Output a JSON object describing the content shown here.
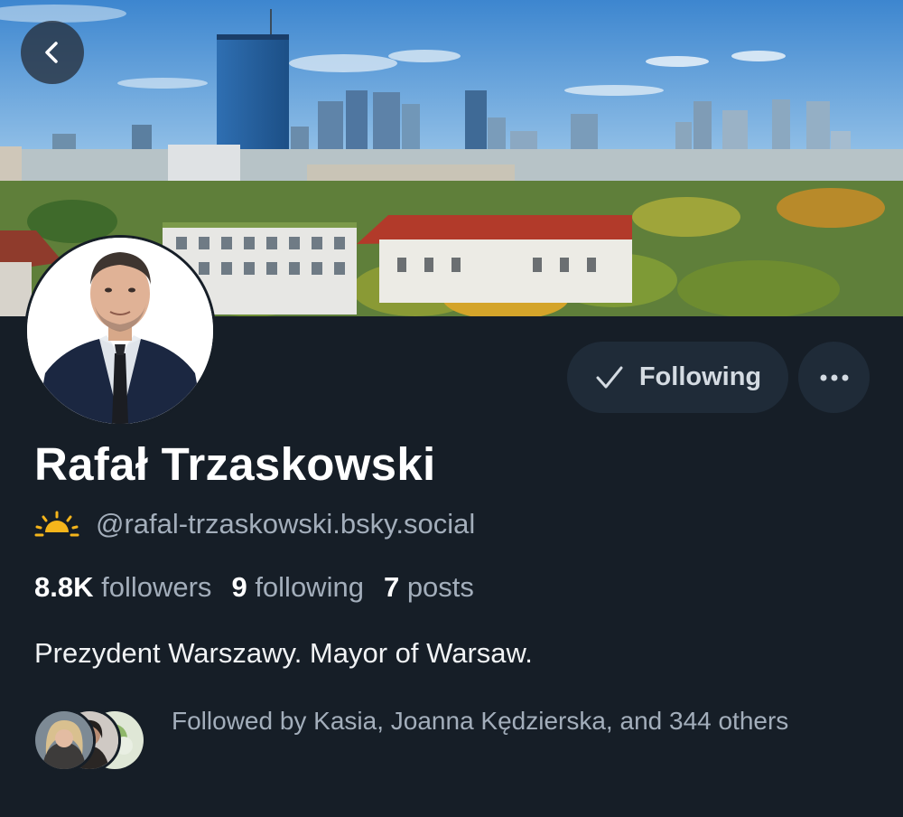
{
  "header": {
    "back_icon": "chevron-left-icon",
    "banner_alt": "Warsaw city skyline"
  },
  "profile": {
    "display_name": "Rafał Trzaskowski",
    "handle_emoji": "sun-rising-icon",
    "handle": "@rafal-trzaskowski.bsky.social",
    "stats": {
      "followers_count": "8.8K",
      "followers_label": "followers",
      "following_count": "9",
      "following_label": "following",
      "posts_count": "7",
      "posts_label": "posts"
    },
    "bio": "Prezydent Warszawy. Mayor of Warsaw.",
    "followed_by": "Followed by Kasia, Joanna Kędzierska, and 344 others"
  },
  "actions": {
    "following_label": "Following",
    "following_icon": "checkmark-icon",
    "more_icon": "ellipsis-icon"
  },
  "colors": {
    "background": "#161e27",
    "button_bg": "#1f2b38",
    "muted_text": "#a3aebb",
    "accent_sun": "#f5b51b"
  }
}
